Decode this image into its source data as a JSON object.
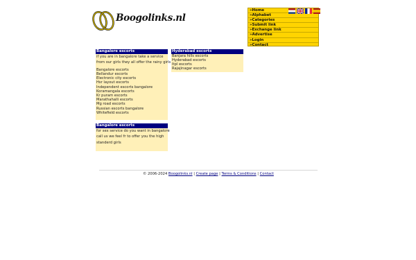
{
  "logo": {
    "text": "Boogolinks.nl"
  },
  "nav": {
    "items": [
      {
        "label": "»Home"
      },
      {
        "label": "»Alphabet"
      },
      {
        "label": "»Categories"
      },
      {
        "label": "»Submit link"
      },
      {
        "label": "»Exchange link"
      },
      {
        "label": "»Advertise"
      },
      {
        "label": "»Login"
      },
      {
        "label": "»Contact"
      }
    ]
  },
  "flags": [
    {
      "name": "dutch-flag",
      "colors": [
        "#ae1c28",
        "#ffffff",
        "#21468b"
      ]
    },
    {
      "name": "english-flag",
      "colors": [
        "#012169",
        "#ffffff",
        "#c8102e"
      ]
    },
    {
      "name": "french-flag",
      "colors": [
        "#002395",
        "#ffffff",
        "#ed2939"
      ]
    },
    {
      "name": "spanish-flag",
      "colors": [
        "#aa151b",
        "#f1bf00",
        "#aa151b"
      ]
    }
  ],
  "bangalore": {
    "title": "Bangalore escorts",
    "intro": [
      "if you are in bangalore take a service",
      "from our girls they all offer the rainy girls"
    ],
    "links": [
      "Bangalore escorts",
      "Bellandur escorts",
      "Electronic city escorts",
      "Hsr layout escorts",
      "Independent escorts bangalore",
      "Koramangala escorts",
      "Kr puram escorts",
      "Marathahalli escorts",
      "Mg road escorts",
      "Russian escorts bangalore",
      "Whitefield escorts"
    ]
  },
  "hyderabad": {
    "title": "Hyderabad escorts",
    "links": [
      "Banjara hills escorts",
      "Hyderabad escorts",
      "Itpl escorts",
      "Rajajinagar escorts"
    ]
  },
  "bangalore2": {
    "title": "Bangalore escorts",
    "lines": [
      "for sex service do you want in bangalore",
      "call us we feel fr to offer you the high",
      "standerd girls"
    ]
  },
  "footer": {
    "copyright": "© 2006-2024",
    "site": "Boogolinks.nl",
    "create": "Create page",
    "terms": "Terms & Conditions",
    "contact": "Contact",
    "sep": "|"
  },
  "colors": {
    "nav_bg": "#ffd400",
    "box_bg": "#fff0b8",
    "head_bg": "#000080",
    "link": "#000080"
  }
}
